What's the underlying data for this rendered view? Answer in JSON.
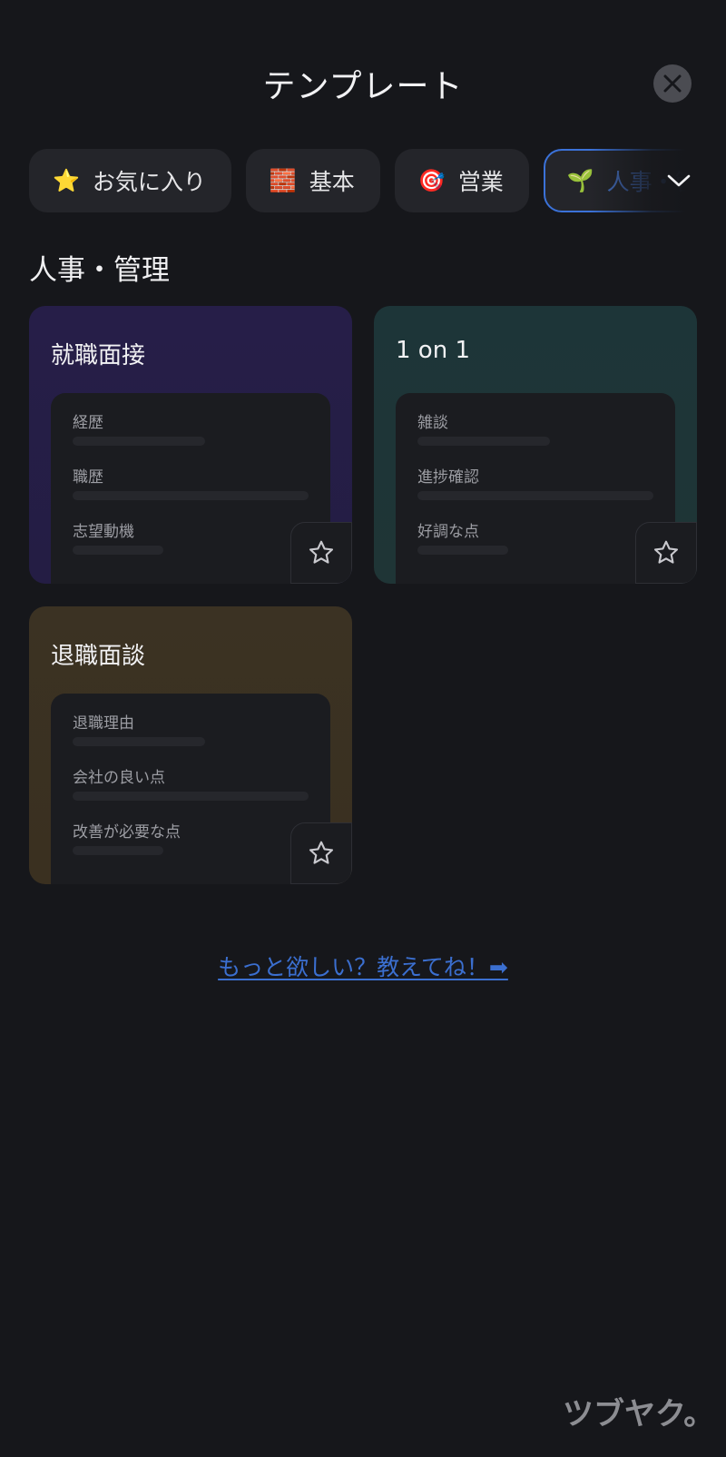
{
  "header": {
    "title": "テンプレート"
  },
  "tabs": [
    {
      "emoji": "⭐",
      "label": "お気に入り",
      "active": false
    },
    {
      "emoji": "🧱",
      "label": "基本",
      "active": false
    },
    {
      "emoji": "🎯",
      "label": "営業",
      "active": false
    },
    {
      "emoji": "🌱",
      "label": "人事・管理",
      "active": true
    }
  ],
  "section": {
    "title": "人事・管理"
  },
  "cards": [
    {
      "title": "就職面接",
      "theme": "purple",
      "fields": [
        "経歴",
        "職歴",
        "志望動機"
      ]
    },
    {
      "title": "1 on 1",
      "theme": "teal",
      "fields": [
        "雑談",
        "進捗確認",
        "好調な点"
      ]
    },
    {
      "title": "退職面談",
      "theme": "gold",
      "fields": [
        "退職理由",
        "会社の良い点",
        "改善が必要な点"
      ]
    }
  ],
  "footer": {
    "link_label": "もっと欲しい？教えてね！➡"
  },
  "brand": {
    "logo_text": "ツブヤク。"
  },
  "colors": {
    "accent": "#3b72d9",
    "link": "#3b6fd0",
    "background": "#16171b"
  }
}
